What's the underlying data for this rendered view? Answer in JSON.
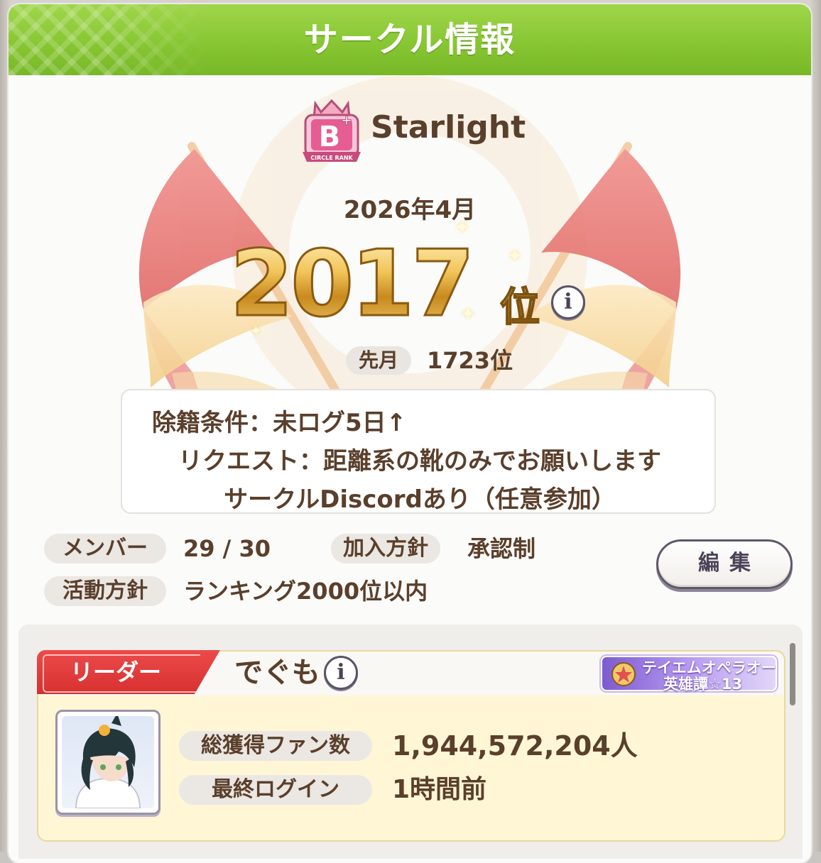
{
  "header": {
    "title": "サークル情報"
  },
  "circle": {
    "rank_badge_text": "CIRCLE RANK",
    "rank_letter": "B",
    "name": "Starlight",
    "month": "2026年4月",
    "rank_number": "2017",
    "rank_suffix": "位",
    "info_glyph": "i",
    "last_month_label": "先月",
    "last_month_value": "1723位"
  },
  "description": {
    "line1": "除籍条件：未ログ5日↑",
    "line2": "リクエスト：距離系の靴のみでお願いします",
    "line3": "サークルDiscordあり（任意参加）"
  },
  "stats": {
    "members_label": "メンバー",
    "members_value": "29 / 30",
    "join_policy_label": "加入方針",
    "join_policy_value": "承認制",
    "activity_label": "活動方針",
    "activity_value": "ランキング2000位以内"
  },
  "edit_button": "編集",
  "leader": {
    "ribbon_label": "リーダー",
    "name": "でぐも",
    "info_glyph": "i",
    "title_line1": "テイエムオペラオー",
    "title_line2": "英雄譚☆13",
    "fans_label": "総獲得ファン数",
    "fans_value": "1,944,572,204人",
    "login_label": "最終ログイン",
    "login_value": "1時間前"
  },
  "colors": {
    "header_green": "#86c531",
    "text_brown": "#5a3f2b",
    "ribbon_red": "#d7302f",
    "rank_gold": "#c88a1e",
    "leader_card_bg": "#fff6d6"
  },
  "icons": [
    "circle-rank-badge-icon",
    "info-icon",
    "sparkle-icon",
    "flag-emblem-icon",
    "title-emblem-icon"
  ]
}
